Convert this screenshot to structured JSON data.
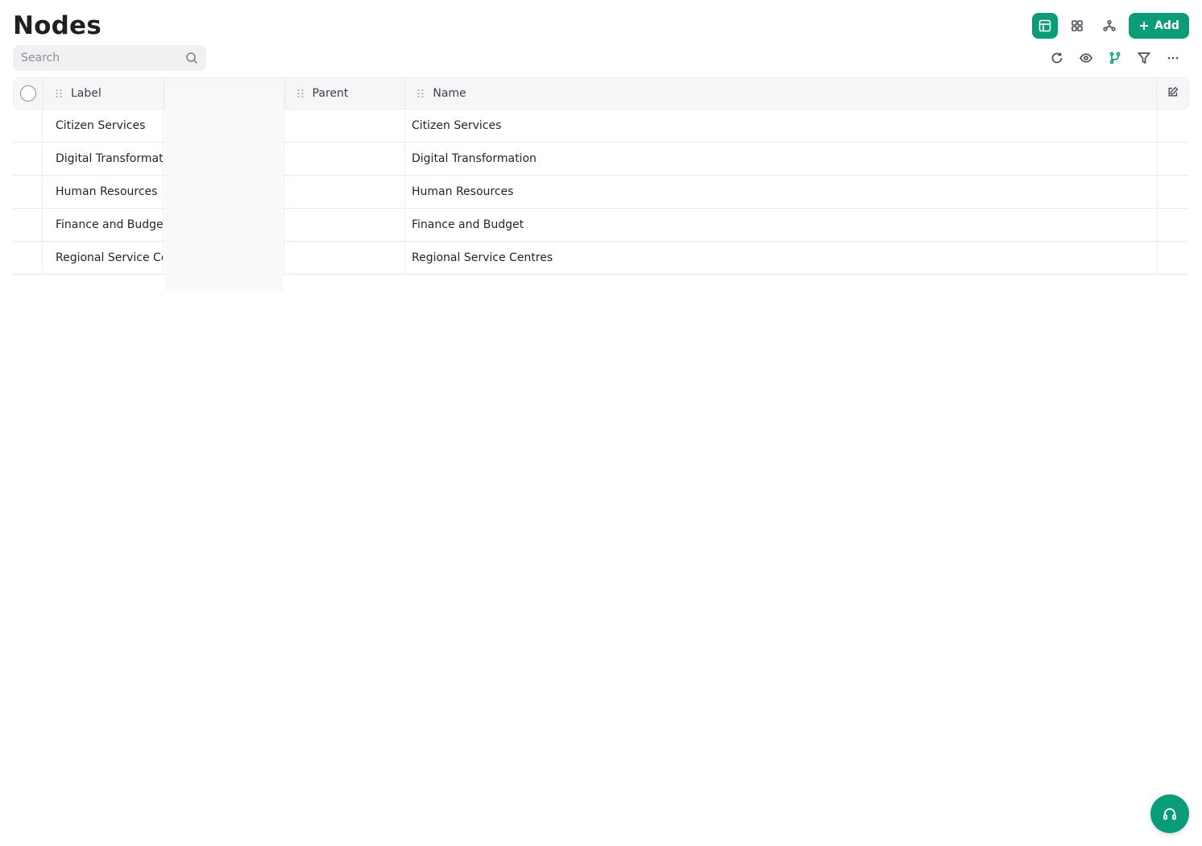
{
  "page": {
    "title": "Nodes"
  },
  "colors": {
    "accent": "#0a9c78",
    "header_bg": "#f5f6f7"
  },
  "view_switcher": {
    "items": [
      {
        "icon": "table-view-icon",
        "active": true
      },
      {
        "icon": "grid-view-icon",
        "active": false
      },
      {
        "icon": "tree-view-icon",
        "active": false
      }
    ]
  },
  "add_button": {
    "label": "Add",
    "icon": "plus-icon"
  },
  "search": {
    "placeholder": "Search",
    "value": "",
    "icon": "search-icon"
  },
  "toolbar": {
    "icons": [
      "refresh-icon",
      "eye-icon",
      "branch-icon",
      "filter-icon",
      "more-icon"
    ]
  },
  "table": {
    "columns": [
      {
        "key": "label",
        "title": "Label"
      },
      {
        "key": "hidden",
        "title": ""
      },
      {
        "key": "parent",
        "title": "Parent"
      },
      {
        "key": "name",
        "title": "Name"
      }
    ],
    "rows": [
      {
        "label": "Citizen Services",
        "parent": "",
        "name": "Citizen Services"
      },
      {
        "label": "Digital Transformation",
        "parent": "",
        "name": "Digital Transformation"
      },
      {
        "label": "Human Resources",
        "parent": "",
        "name": "Human Resources"
      },
      {
        "label": "Finance and Budget",
        "parent": "",
        "name": "Finance and Budget"
      },
      {
        "label": "Regional Service Centres",
        "parent": "",
        "name": "Regional Service Centres"
      }
    ]
  },
  "help": {
    "icon": "headset-icon"
  }
}
